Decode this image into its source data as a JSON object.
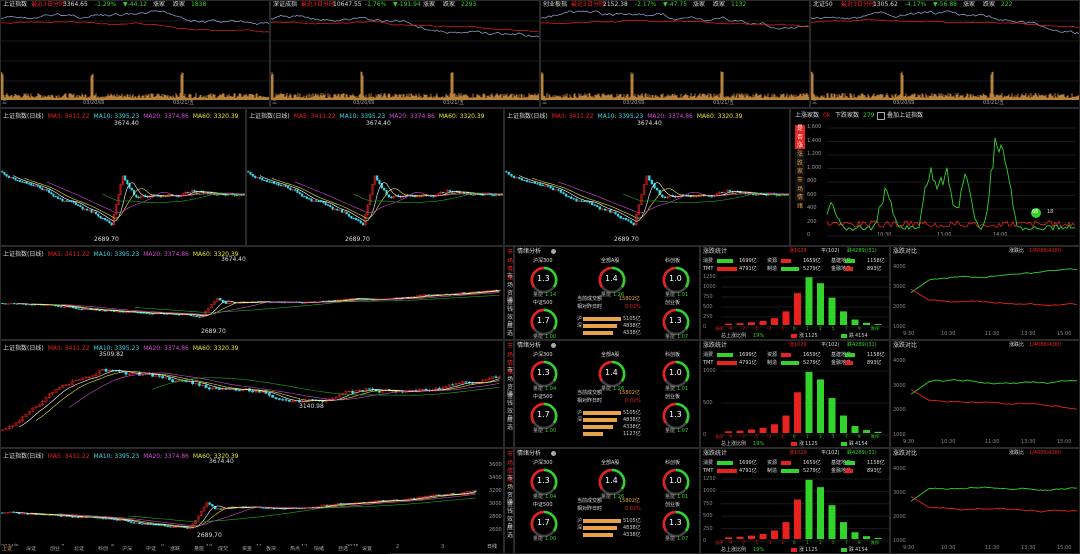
{
  "colors": {
    "up": "#e8221e",
    "down": "#32d32a",
    "ma5": "#ffffff",
    "ma10": "#e6e633",
    "ma20": "#d24bd2",
    "ma60": "#22aa22",
    "amber": "#e8a24a"
  },
  "top_panels": [
    {
      "title": "上证指数",
      "index_label": "最近3日分时",
      "value": "3364.65",
      "chg": "-1.29%",
      "vol": "▼-44.12",
      "up": "涨家",
      "up_n": "",
      "down": "跌家",
      "down_n": "1838",
      "dates": [
        "三",
        "03/20/四",
        "03/21/五"
      ]
    },
    {
      "title": "深证成指",
      "index_label": "最近3日分时",
      "value": "10647.55",
      "chg": "-1.76%",
      "vol": "▼-191.94",
      "up": "涨家",
      "up_n": "",
      "down": "跌家",
      "down_n": "2293",
      "dates": [
        "三",
        "03/20/四",
        "03/21/五"
      ]
    },
    {
      "title": "创业板指",
      "index_label": "最近3日分时",
      "value": "2152.38",
      "chg": "-2.17%",
      "vol": "▼-47.75",
      "up": "涨家",
      "up_n": "",
      "down": "跌家",
      "down_n": "1132",
      "dates": [
        "三",
        "03/20/四",
        "03/21/五"
      ]
    },
    {
      "title": "北证50",
      "index_label": "最近3日分时",
      "value": "1305.62",
      "chg": "-4.17%",
      "vol": "▼-56.88",
      "up": "涨家",
      "up_n": "",
      "down": "跌家",
      "down_n": "222",
      "dates": [
        "三",
        "03/20/四",
        "03/21/五"
      ]
    }
  ],
  "kline_header": {
    "title": "上证指数(日线)",
    "ma5": "MA5: 3411.22",
    "ma10": "MA10: 3395.23",
    "ma20": "MA20: 3374.86",
    "ma60": "MA60: 3320.39"
  },
  "kline_marks": {
    "high": "3674.40",
    "low": "2689.70",
    "mid_high": "3509.82",
    "mid_low": "3140.98"
  },
  "updown_panel": {
    "up_label": "上涨家数",
    "up_val": "0k",
    "down_label": "下跌家数",
    "down_val": "279",
    "overlay": "叠加上证指数",
    "side": [
      "是否涨跌",
      "涨跌家数",
      "市场情绪"
    ],
    "yticks": [
      "1,600",
      "1,400",
      "1,200",
      "1,000",
      "800",
      "600",
      "400",
      "200",
      "0"
    ],
    "xticks": [
      "10:30",
      "13:00",
      "14:00"
    ],
    "bubble": "68",
    "mini_left": "",
    "mini_right": "18"
  },
  "side_tabs": [
    "市场情绪",
    "市场资金",
    "赚钱效应",
    "自选"
  ],
  "rows": [
    {
      "gauge_title": "情绪分析",
      "g": [
        {
          "name": "沪深300",
          "val": "1.3",
          "lbl": "量能",
          "num": "1.14"
        },
        {
          "name": "全部A股",
          "val": "1.4",
          "lbl": "量能",
          "num": "1.26"
        },
        {
          "name": "科创板",
          "val": "1.0",
          "lbl": "量能",
          "num": "1.01"
        },
        {
          "name": "中证500",
          "val": "1.7",
          "lbl": "量能",
          "num": "1.00"
        },
        {
          "name": "创业板",
          "val": "1.3",
          "lbl": "量能",
          "num": "1.07"
        }
      ],
      "center_title": "当前成交额",
      "center_val": "15802亿",
      "center_sub": "相对昨日时",
      "center_pct": "0.02%",
      "bars": [
        {
          "l": "沪",
          "v": "5105亿"
        },
        {
          "l": "深",
          "v": "4838亿"
        },
        {
          "l": "",
          "v": "4338亿"
        }
      ],
      "dist_title": "涨跌统计",
      "dist_up": "涨1029",
      "dist_flat": "平(102)",
      "dist_down": "跌4289(/31)",
      "sectors": [
        {
          "n": "消费",
          "v": "1699亿"
        },
        {
          "n": "资源",
          "v": "1659亿"
        },
        {
          "n": "基建地产",
          "v": "1158亿"
        },
        {
          "n": "TMT",
          "v": "4791亿"
        },
        {
          "n": "制造",
          "v": "5279亿"
        },
        {
          "n": "金融地产",
          "v": "893亿"
        }
      ],
      "dist_y": [
        "1250",
        "1000",
        "750",
        "500",
        "250",
        "0"
      ],
      "dist_x": [
        "涨停",
        "-9",
        "-7",
        "-5",
        "-3",
        "-1",
        "0",
        "1",
        "3",
        "5",
        "7",
        "9",
        "跌停"
      ],
      "dist_vals": [
        30,
        40,
        60,
        90,
        150,
        300,
        700,
        1050,
        920,
        600,
        300,
        120,
        50,
        20
      ],
      "foot": {
        "a": "总上涨比例",
        "ap": "19%",
        "b": "涨",
        "bv": "1125",
        "c": "跌",
        "cv": "4154"
      },
      "comp_title": "涨跌对比",
      "comp_label": "涨跌比",
      "comp_val": "1/4086/4280",
      "comp_y": [
        "4000",
        "3000",
        "2000",
        "1000"
      ],
      "comp_x": [
        "9:30",
        "10:30",
        "11:30",
        "13:30",
        "15:00"
      ]
    },
    {
      "gauge_title": "情绪分析",
      "g": [
        {
          "name": "沪深300",
          "val": "1.3",
          "lbl": "量能",
          "num": "1.04"
        },
        {
          "name": "全部A股",
          "val": "1.4",
          "lbl": "量能",
          "num": "1.26"
        },
        {
          "name": "科创板",
          "val": "1.0",
          "lbl": "量能",
          "num": "1.01"
        },
        {
          "name": "中证500",
          "val": "1.7",
          "lbl": "量能",
          "num": "1.00"
        },
        {
          "name": "创业板",
          "val": "1.3",
          "lbl": "量能",
          "num": "1.07"
        }
      ],
      "center_title": "当前成交额",
      "center_val": "15802亿",
      "center_sub": "相对昨日时",
      "center_pct": "0.02%",
      "bars": [
        {
          "l": "沪",
          "v": "5105亿"
        },
        {
          "l": "深",
          "v": "4838亿"
        },
        {
          "l": "",
          "v": "4338亿"
        },
        {
          "l": "",
          "v": "1127亿"
        }
      ],
      "dist_title": "涨跌统计",
      "dist_up": "涨1029",
      "dist_flat": "平(102)",
      "dist_down": "跌4289(/31)",
      "sectors": [
        {
          "n": "消费",
          "v": "1699亿"
        },
        {
          "n": "资源",
          "v": "1659亿"
        },
        {
          "n": "基建地产",
          "v": "1158亿"
        },
        {
          "n": "TMT",
          "v": "4791亿"
        },
        {
          "n": "制造",
          "v": "5279亿"
        },
        {
          "n": "金融地产",
          "v": "893亿"
        }
      ],
      "dist_y": [
        "1000",
        "500",
        "0"
      ],
      "dist_x": [
        "涨停",
        "-9",
        "-7",
        "-5",
        "-3",
        "-1",
        "0",
        "1",
        "3",
        "5",
        "7",
        "9",
        "跌停"
      ],
      "dist_vals": [
        30,
        40,
        60,
        90,
        150,
        300,
        700,
        1050,
        920,
        600,
        300,
        120,
        50,
        20
      ],
      "foot": {
        "a": "总上涨比例",
        "ap": "19%",
        "b": "涨",
        "bv": "1125",
        "c": "跌",
        "cv": "4154"
      },
      "comp_title": "涨跌对比",
      "comp_label": "涨跌比",
      "comp_val": "1/4086/4280",
      "comp_y": [
        "4000",
        "3000",
        "2000",
        "1000"
      ],
      "comp_x": [
        "9:30",
        "10:30",
        "11:30",
        "13:30",
        "15:00"
      ]
    },
    {
      "gauge_title": "情绪分析",
      "g": [
        {
          "name": "沪深300",
          "val": "1.3",
          "lbl": "量能",
          "num": "1.04"
        },
        {
          "name": "全部A股",
          "val": "1.4",
          "lbl": "量能",
          "num": "1.26"
        },
        {
          "name": "科创板",
          "val": "1.0",
          "lbl": "量能",
          "num": "1.01"
        },
        {
          "name": "中证500",
          "val": "1.7",
          "lbl": "量能",
          "num": "1.00"
        },
        {
          "name": "创业板",
          "val": "1.3",
          "lbl": "量能",
          "num": "1.07"
        }
      ],
      "center_title": "当前成交额",
      "center_val": "15802亿",
      "center_sub": "相对昨日时",
      "center_pct": "0.02%",
      "bars": [
        {
          "l": "沪",
          "v": "5105亿"
        },
        {
          "l": "深",
          "v": "4838亿"
        },
        {
          "l": "",
          "v": "4338亿"
        }
      ],
      "dist_title": "涨跌统计",
      "dist_up": "涨1029",
      "dist_flat": "平(102)",
      "dist_down": "跌4289(/31)",
      "sectors": [
        {
          "n": "消费",
          "v": "1699亿"
        },
        {
          "n": "资源",
          "v": "1659亿"
        },
        {
          "n": "基建地产",
          "v": "1158亿"
        },
        {
          "n": "TMT",
          "v": "4791亿"
        },
        {
          "n": "制造",
          "v": "5279亿"
        },
        {
          "n": "金融地产",
          "v": "893亿"
        }
      ],
      "dist_y": [
        "1250",
        "1000",
        "750",
        "500",
        "250",
        "0"
      ],
      "dist_x": [
        "涨停",
        "-9",
        "-7",
        "-5",
        "-3",
        "-1",
        "0",
        "1",
        "3",
        "5",
        "7",
        "9",
        "跌停"
      ],
      "dist_vals": [
        30,
        40,
        60,
        90,
        150,
        300,
        700,
        1050,
        920,
        600,
        300,
        120,
        50,
        20
      ],
      "foot": {
        "a": "总上涨比例",
        "ap": "19%",
        "b": "涨",
        "bv": "1125",
        "c": "跌",
        "cv": "4154"
      },
      "comp_title": "涨跌对比",
      "comp_label": "涨跌比",
      "comp_val": "1/4086/4280",
      "comp_y": [
        "4000",
        "3000",
        "2000",
        "1000"
      ],
      "comp_x": [
        "9:30",
        "10:30",
        "11:30",
        "13:30",
        "15:00"
      ]
    }
  ],
  "bottom_kline": {
    "yticks": [
      "3600",
      "3400",
      "3200",
      "3000",
      "2800",
      "2600"
    ],
    "xticks": [
      "2024年",
      "7",
      "8",
      "9",
      "10",
      "11",
      "12",
      "2025",
      "2",
      "3"
    ],
    "right_label": "日线"
  },
  "status_items": [
    "上证",
    "深证",
    "创业",
    "北证",
    "科创",
    "沪深",
    "中证",
    "涨跌",
    "量能",
    "成交",
    "资金",
    "板块",
    "热点",
    "情绪",
    "自选",
    "设置"
  ]
}
